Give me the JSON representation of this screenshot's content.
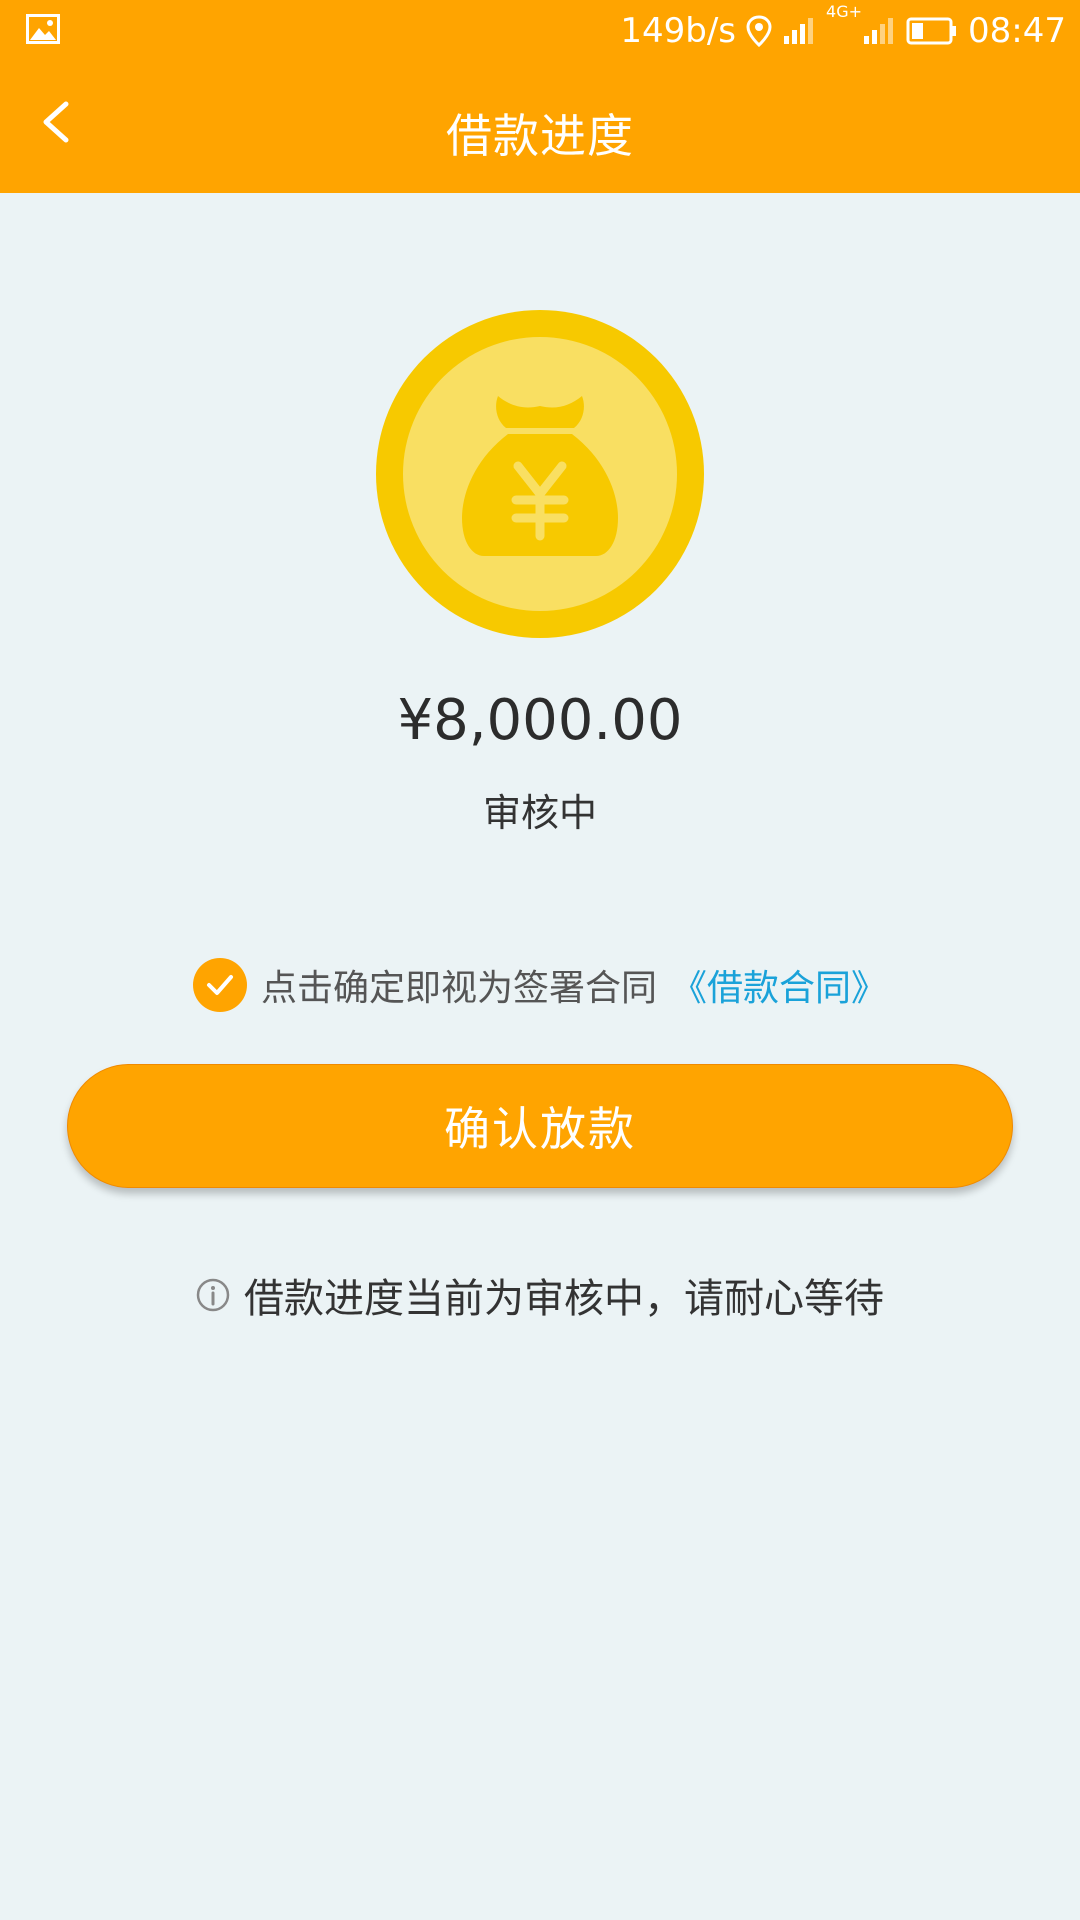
{
  "status_bar": {
    "network_speed": "149b/s",
    "network_type": "4G+",
    "time": "08:47",
    "icons": [
      "image-icon",
      "location-icon",
      "signal-icon",
      "signal-4g-icon",
      "battery-icon"
    ]
  },
  "app_bar": {
    "title": "借款进度",
    "back_icon": "chevron-left-icon"
  },
  "loan": {
    "amount": "¥8,000.00",
    "status": "审核中",
    "icon": "money-bag-coin-icon"
  },
  "agreement": {
    "checked": true,
    "text": "点击确定即视为签署合同",
    "link": "《借款合同》"
  },
  "confirm_button": {
    "label": "确认放款"
  },
  "info_note": {
    "icon": "info-icon",
    "text": "借款进度当前为审核中，请耐心等待"
  },
  "colors": {
    "primary": "#ffa400",
    "background": "#ebf3f5",
    "link": "#1aa2d9",
    "coin_outer": "#f7c900",
    "coin_inner": "#f9df62"
  }
}
